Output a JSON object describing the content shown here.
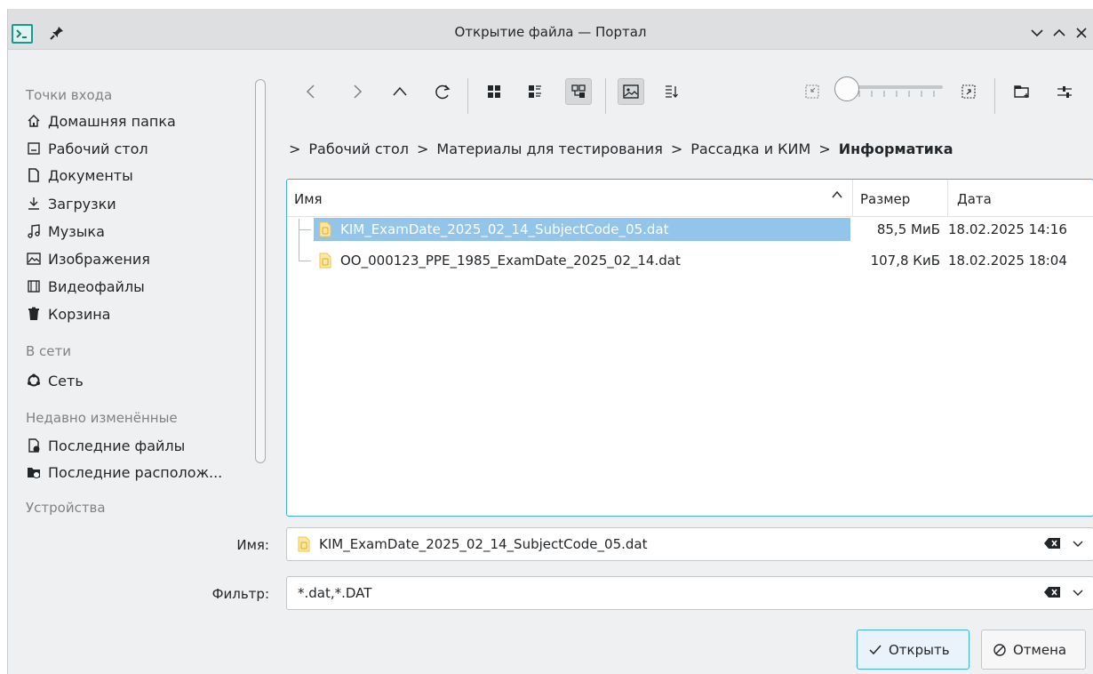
{
  "window": {
    "title": "Открытие файла — Портал"
  },
  "sidebar": {
    "section_places": "Точки входа",
    "places": [
      {
        "label": "Домашняя папка",
        "icon": "home-icon"
      },
      {
        "label": "Рабочий стол",
        "icon": "desktop-icon"
      },
      {
        "label": "Документы",
        "icon": "documents-icon"
      },
      {
        "label": "Загрузки",
        "icon": "downloads-icon"
      },
      {
        "label": "Музыка",
        "icon": "music-icon"
      },
      {
        "label": "Изображения",
        "icon": "pictures-icon"
      },
      {
        "label": "Видеофайлы",
        "icon": "videos-icon"
      },
      {
        "label": "Корзина",
        "icon": "trash-icon"
      }
    ],
    "section_network": "В сети",
    "network": [
      {
        "label": "Сеть",
        "icon": "network-icon"
      }
    ],
    "section_recent": "Недавно изменённые",
    "recent": [
      {
        "label": "Последние файлы",
        "icon": "recent-files-icon"
      },
      {
        "label": "Последние располож...",
        "icon": "recent-locations-icon"
      }
    ],
    "section_devices": "Устройства"
  },
  "breadcrumb": [
    "Рабочий стол",
    "Материалы для тестирования",
    "Рассадка и КИМ",
    "Информатика"
  ],
  "file_table": {
    "columns": {
      "name": "Имя",
      "size": "Размер",
      "date": "Дата"
    },
    "rows": [
      {
        "name": "KIM_ExamDate_2025_02_14_SubjectCode_05.dat",
        "size": "85,5 МиБ",
        "date": "18.02.2025 14:16",
        "selected": true
      },
      {
        "name": "OO_000123_PPE_1985_ExamDate_2025_02_14.dat",
        "size": "107,8 КиБ",
        "date": "18.02.2025 18:04",
        "selected": false
      }
    ]
  },
  "form": {
    "name_label": "Имя:",
    "name_value": "KIM_ExamDate_2025_02_14_SubjectCode_05.dat",
    "filter_label": "Фильтр:",
    "filter_value": "*.dat,*.DAT"
  },
  "buttons": {
    "open": "Открыть",
    "cancel": "Отмена"
  },
  "colors": {
    "accent": "#3daee9",
    "selection": "#93c4ea",
    "file_icon": "#f3c44a"
  }
}
